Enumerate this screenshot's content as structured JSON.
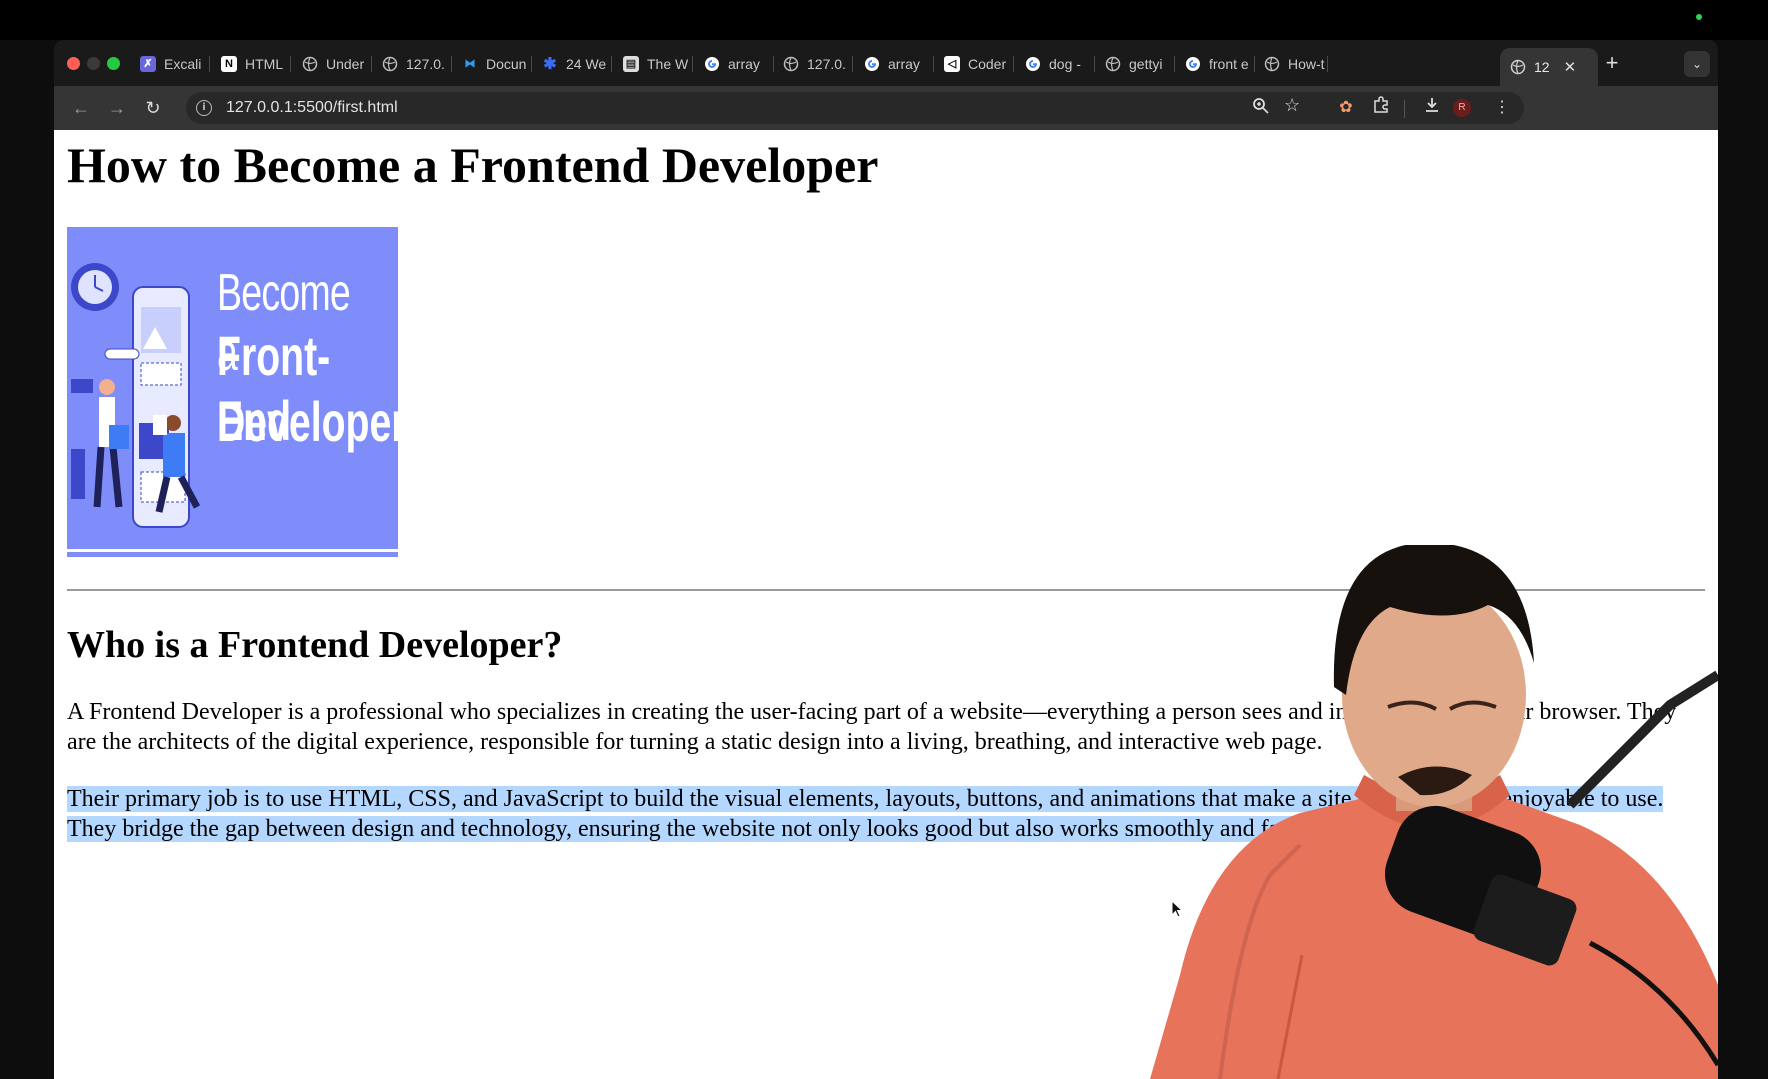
{
  "browser": {
    "tabs": [
      {
        "title": "Excali",
        "favicon": "excalidraw-icon",
        "color": "#6965db"
      },
      {
        "title": "HTML",
        "favicon": "notion-icon",
        "color": "#ffffff"
      },
      {
        "title": "Under",
        "favicon": "globe-icon",
        "color": "#bbbbbb"
      },
      {
        "title": "127.0.",
        "favicon": "globe-icon",
        "color": "#bbbbbb"
      },
      {
        "title": "Docun",
        "favicon": "vscode-icon",
        "color": "#2f9bf0"
      },
      {
        "title": "24 We",
        "favicon": "asterisk-icon",
        "color": "#3b6cf5"
      },
      {
        "title": "The W",
        "favicon": "page-icon",
        "color": "#dddddd"
      },
      {
        "title": "array",
        "favicon": "google-icon",
        "color": "#4285f4"
      },
      {
        "title": "127.0.",
        "favicon": "globe-icon",
        "color": "#bbbbbb"
      },
      {
        "title": "array",
        "favicon": "google-icon",
        "color": "#4285f4"
      },
      {
        "title": "Coder",
        "favicon": "codex-icon",
        "color": "#ffffff"
      },
      {
        "title": "dog -",
        "favicon": "google-icon",
        "color": "#4285f4"
      },
      {
        "title": "gettyi",
        "favicon": "globe-icon",
        "color": "#bbbbbb"
      },
      {
        "title": "front e",
        "favicon": "google-icon",
        "color": "#4285f4"
      },
      {
        "title": "How-t",
        "favicon": "globe-icon",
        "color": "#bbbbbb"
      }
    ],
    "active_tab": {
      "title": "12",
      "favicon": "globe-icon"
    },
    "url": "127.0.0.1:5500/first.html",
    "profile_initial": "R"
  },
  "page": {
    "heading": "How to Become a Frontend Developer",
    "hero_image": {
      "line1": "Become a",
      "line2": "Front-End",
      "line3": "Developer",
      "background": "#7f8dfb"
    },
    "subheading": "Who is a Frontend Developer?",
    "paragraph1": "A Frontend Developer is a professional who specializes in creating the user-facing part of a website—everything a person sees and interacts with in their browser. They are the architects of the digital experience, responsible for turning a static design into a living, breathing, and interactive web page.",
    "paragraph2": "Their primary job is to use HTML, CSS, and JavaScript to build the visual elements, layouts, buttons, and animations that make a site functional and enjoyable to use. They bridge the gap between design and technology, ensuring the website not only looks good but also works smoothly and fast."
  },
  "colors": {
    "selection": "#b4d7ff",
    "tab_bg": "#1a1a1a",
    "toolbar_bg": "#353535"
  }
}
